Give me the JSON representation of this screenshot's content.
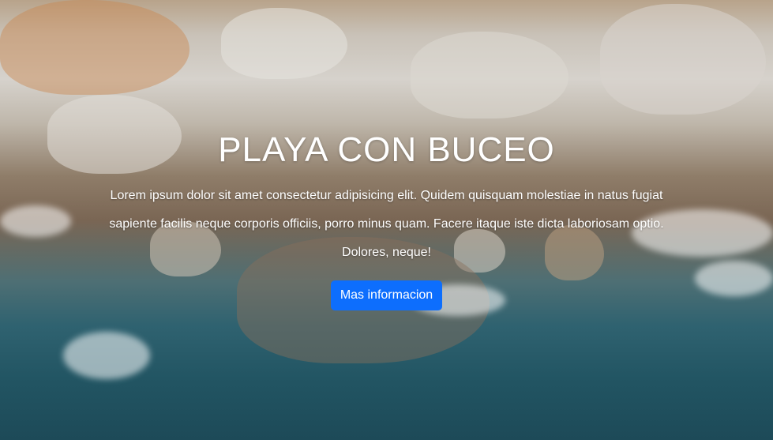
{
  "hero": {
    "title": "PLAYA CON BUCEO",
    "description": "Lorem ipsum dolor sit amet consectetur adipisicing elit. Quidem quisquam molestiae in natus fugiat sapiente facilis neque corporis officiis, porro minus quam. Facere itaque iste dicta laboriosam optio. Dolores, neque!",
    "button_label": "Mas informacion",
    "accent_color": "#0d6efd"
  }
}
